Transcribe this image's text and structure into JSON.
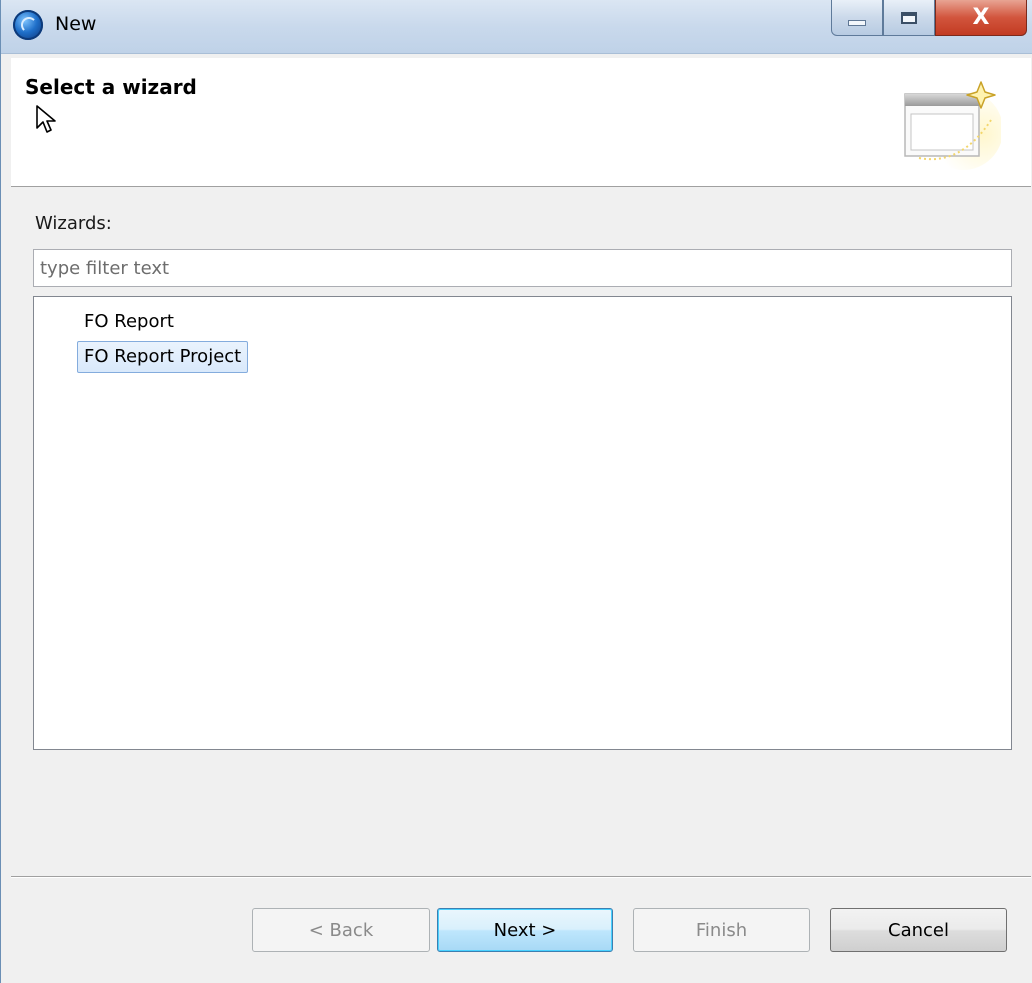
{
  "window": {
    "title": "New",
    "close_glyph": "X",
    "controls": [
      "minimize-icon",
      "maximize-icon",
      "close-icon"
    ]
  },
  "banner": {
    "title": "Select a wizard",
    "icon": "new-wizard-icon"
  },
  "main": {
    "wizards_label": "Wizards:",
    "filter_placeholder": "type filter text",
    "filter_value": "",
    "items": [
      {
        "label": "FO Report",
        "selected": false
      },
      {
        "label": "FO Report Project",
        "selected": true
      }
    ]
  },
  "footer": {
    "back_label": "< Back",
    "next_label": "Next >",
    "finish_label": "Finish",
    "cancel_label": "Cancel"
  },
  "colors": {
    "selection_fill": "#d9e9fb",
    "selection_border": "#84acdd",
    "default_button": "#bee6fd",
    "close_button": "#c23b22"
  }
}
